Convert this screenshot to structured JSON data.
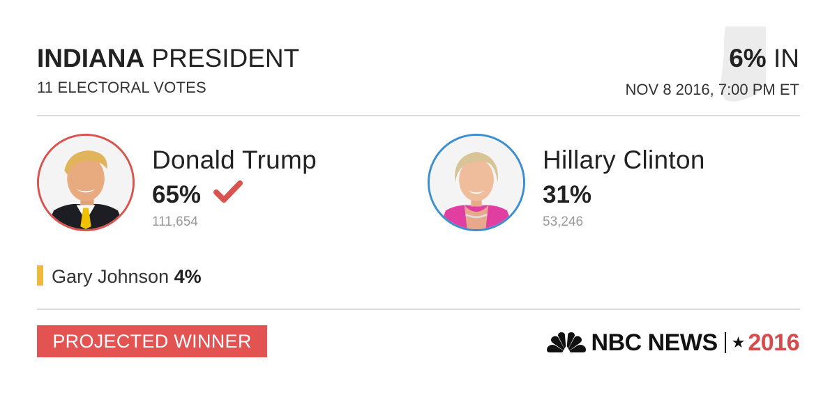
{
  "race": {
    "state": "INDIANA",
    "office": "PRESIDENT",
    "electoral_votes": "11 ELECTORAL VOTES",
    "reporting_pct": "6%",
    "reporting_suffix": "IN",
    "timestamp": "NOV 8 2016, 7:00 PM ET"
  },
  "candidates": [
    {
      "name": "Donald Trump",
      "pct": "65%",
      "votes": "111,654",
      "winner": true,
      "color": "#d9534f"
    },
    {
      "name": "Hillary Clinton",
      "pct": "31%",
      "votes": "53,246",
      "winner": false,
      "color": "#3b8fd0"
    }
  ],
  "third_party": {
    "name": "Gary Johnson",
    "pct": "4%",
    "color": "#f2b83b"
  },
  "badge": {
    "label": "PROJECTED WINNER",
    "color": "#e25352"
  },
  "branding": {
    "network": "NBC NEWS",
    "year": "2016"
  },
  "icons": {
    "state_map": "indiana-map-icon",
    "winner": "checkmark-icon",
    "logo": "nbc-peacock-icon",
    "star": "star-icon"
  }
}
